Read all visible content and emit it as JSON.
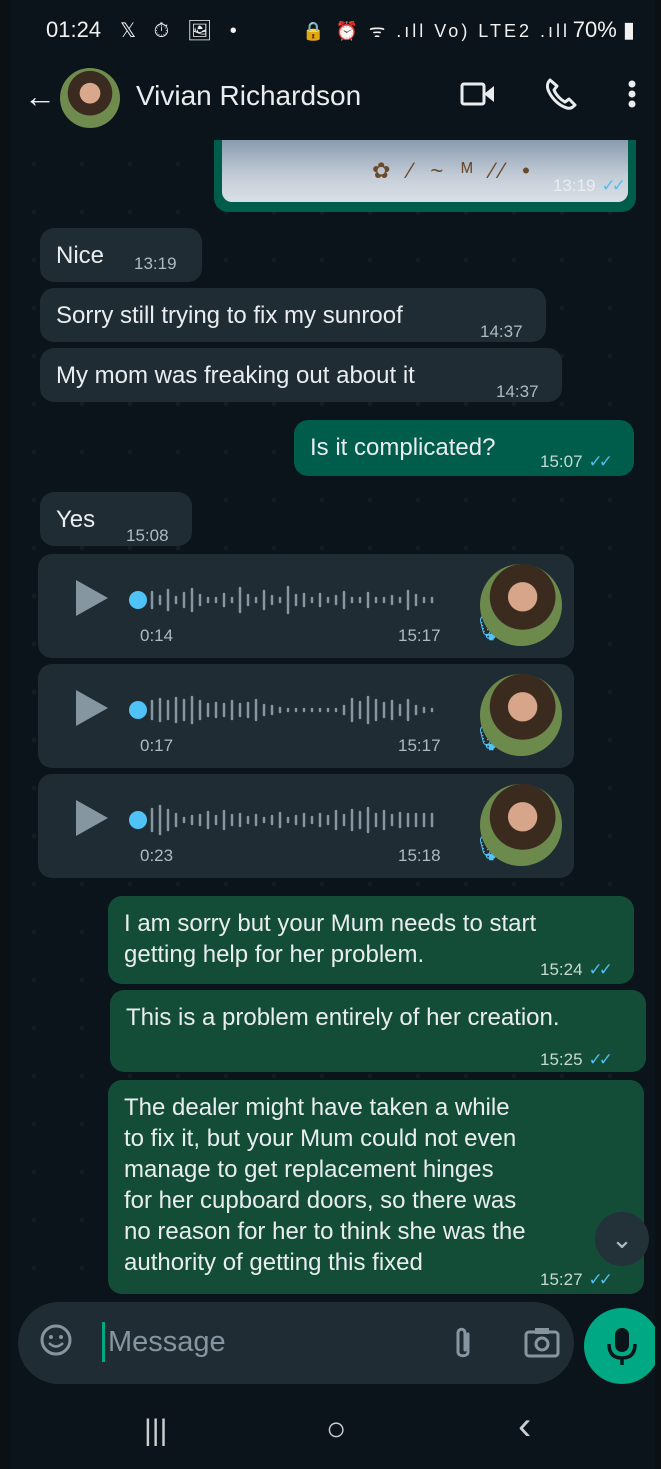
{
  "status_bar": {
    "time": "01:24",
    "left_icons": "𝕏 ⏱ 🖼 •",
    "right_icons": "🔒 ⏰ ᯤ .ıll Vo) LTE2 .ıll",
    "battery": "70%"
  },
  "header": {
    "back_icon": "arrow-left-icon",
    "contact_name": "Vivian Richardson",
    "video_icon": "video-call-icon",
    "call_icon": "phone-icon",
    "menu_icon": "kebab-menu-icon"
  },
  "messages": {
    "image_msg": {
      "time": "13:19"
    },
    "m1": {
      "text": "Nice",
      "time": "13:19"
    },
    "m2": {
      "text": "Sorry still trying to fix my sunroof",
      "time": "14:37"
    },
    "m3": {
      "text": "My mom was freaking out about it",
      "time": "14:37"
    },
    "m4": {
      "text": "Is it complicated?",
      "time": "15:07"
    },
    "m5": {
      "text": "Yes",
      "time": "15:08"
    },
    "voice": [
      {
        "duration": "0:14",
        "time": "15:17"
      },
      {
        "duration": "0:17",
        "time": "15:17"
      },
      {
        "duration": "0:23",
        "time": "15:18"
      }
    ],
    "m6": {
      "text": "I am sorry but your Mum needs to start\ngetting help for her problem.",
      "time": "15:24"
    },
    "m7": {
      "text": "This is a problem entirely of her creation.",
      "time": "15:25"
    },
    "m8": {
      "text": "The dealer might have taken a while\nto fix it, but your Mum could not even\nmanage to get replacement hinges\nfor her cupboard doors, so there was\nno reason for her to think she was the\nauthority of getting this fixed",
      "time": "15:27"
    },
    "ticks": "✓✓"
  },
  "input_bar": {
    "placeholder": "Message",
    "emoji_icon": "sticker-icon",
    "attach_icon": "paperclip-icon",
    "camera_icon": "camera-icon",
    "mic_icon": "microphone-icon"
  },
  "nav": {
    "recents": "|||",
    "home": "○",
    "back": "‹"
  },
  "colors": {
    "background": "#0b141a",
    "incoming": "#202c33",
    "outgoing": "#005c4b",
    "accent": "#00a884",
    "read_ticks": "#53bdeb"
  }
}
